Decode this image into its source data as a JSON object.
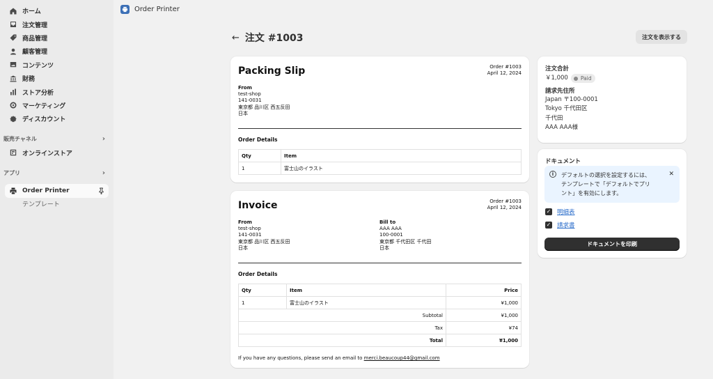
{
  "sidebar": {
    "items": [
      {
        "label": "ホーム",
        "icon": "home-icon"
      },
      {
        "label": "注文管理",
        "icon": "inbox-icon"
      },
      {
        "label": "商品管理",
        "icon": "tag-icon"
      },
      {
        "label": "顧客管理",
        "icon": "person-icon"
      },
      {
        "label": "コンテンツ",
        "icon": "image-icon"
      },
      {
        "label": "財務",
        "icon": "bank-icon"
      },
      {
        "label": "ストア分析",
        "icon": "bar-chart-icon"
      },
      {
        "label": "マーケティング",
        "icon": "target-icon"
      },
      {
        "label": "ディスカウント",
        "icon": "discount-icon"
      }
    ],
    "sales_channels_heading": "販売チャネル",
    "online_store": "オンラインストア",
    "apps_heading": "アプリ",
    "app_name": "Order Printer",
    "app_sub": "テンプレート"
  },
  "topbar": {
    "app_title": "Order Printer"
  },
  "page": {
    "title": "注文 #1003",
    "view_order_button": "注文を表示する"
  },
  "packing_slip": {
    "title": "Packing Slip",
    "order_no": "Order #1003",
    "date": "April 12, 2024",
    "from_label": "From",
    "from_lines": [
      "test-shop",
      "141-0031",
      "東京都 品川区 西五反田",
      "日本"
    ],
    "order_details_label": "Order Details",
    "headers": [
      "Qty",
      "Item"
    ],
    "rows": [
      [
        "1",
        "富士山のイラスト"
      ]
    ]
  },
  "invoice": {
    "title": "Invoice",
    "order_no": "Order #1003",
    "date": "April 12, 2024",
    "from_label": "From",
    "from_lines": [
      "test-shop",
      "141-0031",
      "東京都 品川区 西五反田",
      "日本"
    ],
    "bill_to_label": "Bill to",
    "bill_to_lines": [
      "AAA AAA",
      "100-0001",
      "東京都 千代田区 千代田",
      "日本"
    ],
    "order_details_label": "Order Details",
    "headers": [
      "Qty",
      "Item",
      "Price"
    ],
    "rows": [
      [
        "1",
        "富士山のイラスト",
        "¥1,000"
      ]
    ],
    "subtotal_label": "Subtotal",
    "subtotal": "¥1,000",
    "tax_label": "Tax",
    "tax": "¥74",
    "total_label": "Total",
    "total": "¥1,000",
    "footer_text": "If you have any questions, please send an email to",
    "footer_email": "merci.beaucoup44@gmail.com"
  },
  "summary": {
    "total_label": "注文合計",
    "total_value": "￥1,000",
    "status_badge": "Paid",
    "billing_label": "請求先住所",
    "billing_lines": [
      "Japan 〒100-0001",
      "Tokyo 千代田区",
      "千代田",
      "AAA AAA様"
    ]
  },
  "documents": {
    "label": "ドキュメント",
    "banner_line1": "デフォルトの選択を設定するには、",
    "banner_line2": "テンプレートで「デフォルトでプリ",
    "banner_line3": "ント」を有効にします。",
    "checks": [
      "明細表",
      "請求書"
    ],
    "print_button": "ドキュメントを印刷"
  },
  "colors": {
    "accent_dark": "#303030",
    "link": "#2c6ecb",
    "info_bg": "#eaf4ff"
  }
}
